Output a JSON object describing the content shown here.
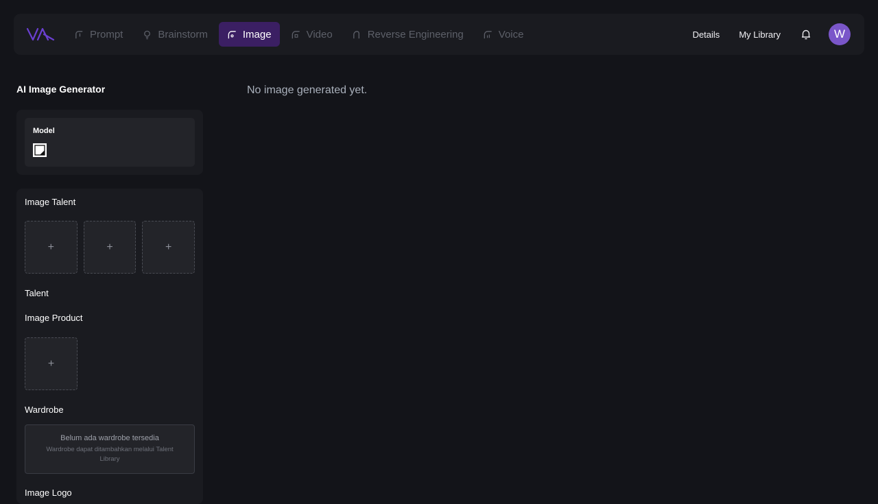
{
  "nav": {
    "tabs": [
      {
        "label": "Prompt",
        "icon": "prompt-icon",
        "active": false
      },
      {
        "label": "Brainstorm",
        "icon": "bulb-icon",
        "active": false
      },
      {
        "label": "Image",
        "icon": "image-icon",
        "active": true
      },
      {
        "label": "Video",
        "icon": "video-icon",
        "active": false
      },
      {
        "label": "Reverse Engineering",
        "icon": "reverse-icon",
        "active": false
      },
      {
        "label": "Voice",
        "icon": "voice-icon",
        "active": false
      }
    ],
    "details_label": "Details",
    "library_label": "My Library",
    "avatar_initial": "W"
  },
  "colors": {
    "accent": "#3b1f63",
    "avatar": "#7a56c9",
    "logo": "#6a3fd0"
  },
  "sidebar": {
    "title": "AI Image Generator",
    "model_label": "Model",
    "image_talent_label": "Image Talent",
    "talent_label": "Talent",
    "image_product_label": "Image Product",
    "wardrobe_label": "Wardrobe",
    "wardrobe_empty_title": "Belum ada wardrobe tersedia",
    "wardrobe_empty_sub": "Wardrobe dapat ditambahkan melalui Talent Library",
    "image_logo_label": "Image Logo",
    "add_symbol": "+"
  },
  "main": {
    "empty_message": "No image generated yet."
  }
}
